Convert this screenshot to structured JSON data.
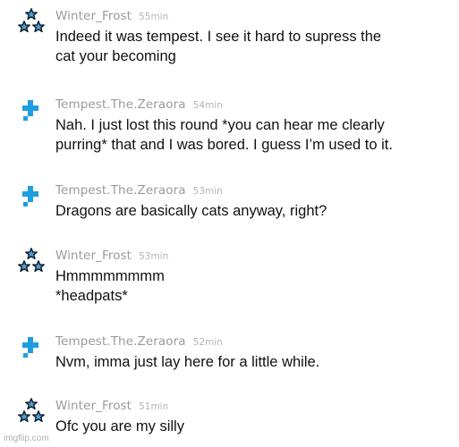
{
  "messages": [
    {
      "avatar": "stars-icon",
      "username": "Winter_Frost",
      "time": "55min",
      "lines": [
        "Indeed it was tempest. I see it hard to supress the",
        "cat your becoming"
      ]
    },
    {
      "avatar": "plus-icon",
      "username": "Tempest.The.Zeraora",
      "time": "54min",
      "lines": [
        "Nah. I just lost this round *you can hear me clearly",
        "purring* that and I was bored. I guess I’m used to it."
      ]
    },
    {
      "avatar": "plus-icon",
      "username": "Tempest.The.Zeraora",
      "time": "53min",
      "lines": [
        "Dragons are basically cats anyway, right?"
      ]
    },
    {
      "avatar": "stars-icon",
      "username": "Winter_Frost",
      "time": "53min",
      "lines": [
        "Hmmmmmmmm",
        "*headpats*"
      ]
    },
    {
      "avatar": "plus-icon",
      "username": "Tempest.The.Zeraora",
      "time": "52min",
      "lines": [
        "Nvm, imma just lay here for a little while."
      ]
    },
    {
      "avatar": "stars-icon",
      "username": "Winter_Frost",
      "time": "51min",
      "lines": [
        "Ofc you are my silly"
      ]
    }
  ],
  "colors": {
    "plus_icon": "#1e9de0",
    "star_fill": "#4f9dd0",
    "star_outline": "#0d1b2a"
  },
  "watermark": "imgflip.com"
}
